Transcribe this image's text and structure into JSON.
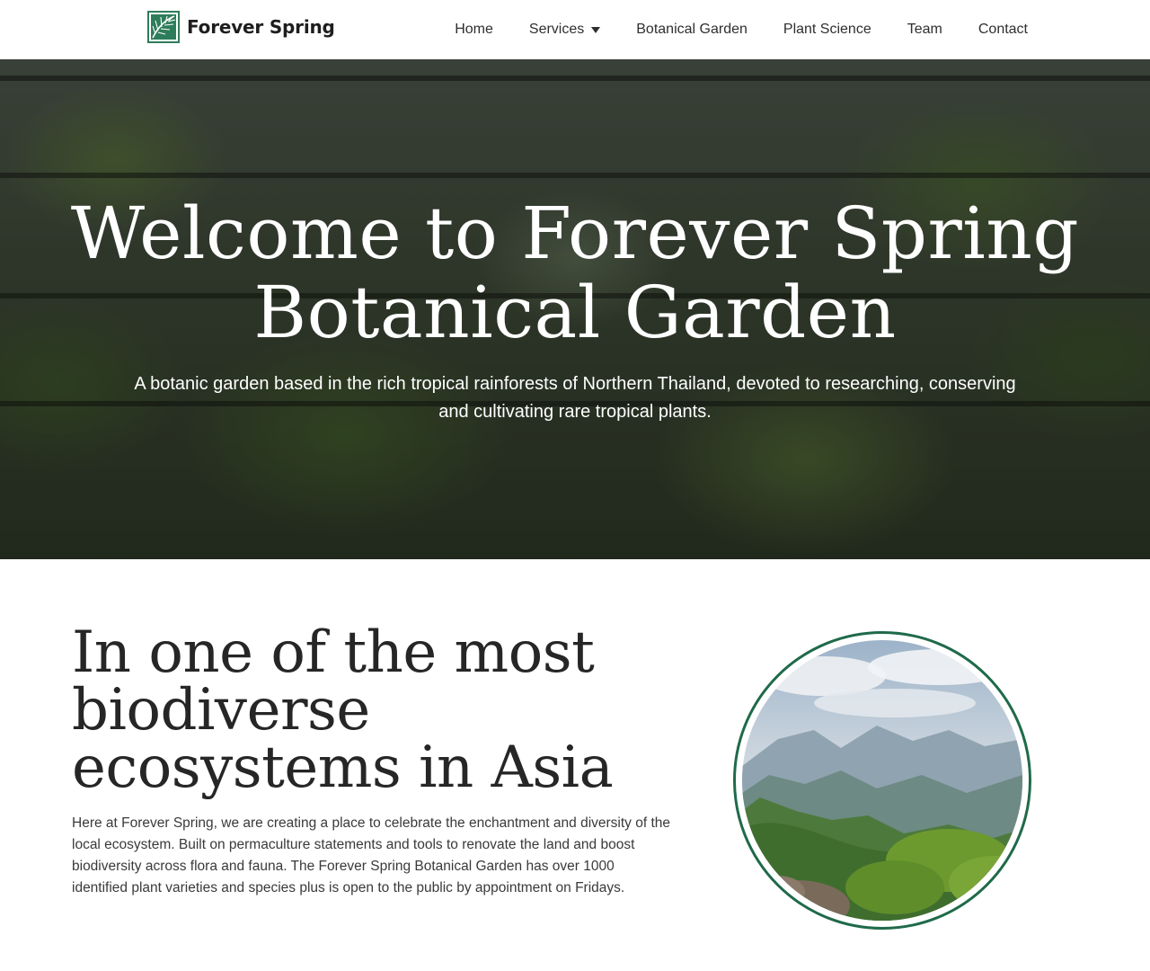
{
  "header": {
    "logo_text": "Forever Spring",
    "logo_icon": "leaf-icon",
    "nav": [
      {
        "label": "Home"
      },
      {
        "label": "Services",
        "icon": "caret-down-icon"
      },
      {
        "label": "Botanical Garden"
      },
      {
        "label": "Plant Science"
      },
      {
        "label": "Team"
      },
      {
        "label": "Contact"
      }
    ]
  },
  "hero": {
    "title": "Welcome to Forever Spring Botanical Garden",
    "subtitle": "A botanic garden based in the rich tropical rainforests of Northern Thailand, devoted to researching, conserving and cultivating rare tropical plants."
  },
  "intro": {
    "title": "In one of the most biodiverse ecosystems in Asia",
    "text": "Here at Forever Spring, we are creating a place to celebrate the enchantment and diversity of the local ecosystem. Built on permaculture statements and tools to renovate the land and boost biodiversity across flora and fauna. The Forever Spring Botanical Garden has over 1000 identified plant varieties and species plus is open to the public by appointment on Fridays."
  },
  "colors": {
    "brand_green": "#1f6a4a",
    "text_dark": "#262626",
    "white": "#ffffff"
  }
}
